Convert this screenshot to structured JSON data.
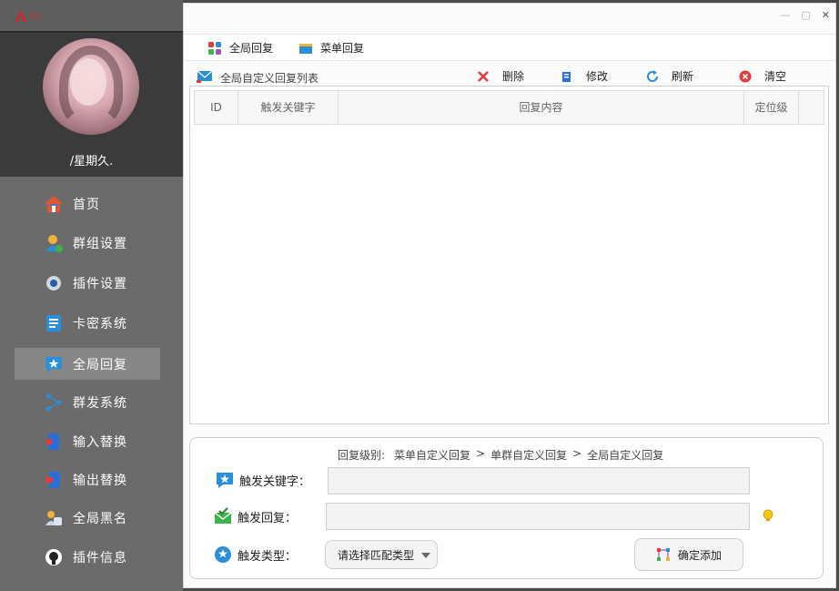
{
  "sidebar": {
    "logo_text": "花开",
    "username": "/星期久.",
    "items": [
      {
        "label": "首页",
        "icon": "home-icon"
      },
      {
        "label": "群组设置",
        "icon": "group-icon"
      },
      {
        "label": "插件设置",
        "icon": "gear-icon"
      },
      {
        "label": "卡密系统",
        "icon": "card-icon"
      },
      {
        "label": "全局回复",
        "icon": "star-chat-icon",
        "active": true
      },
      {
        "label": "群发系统",
        "icon": "broadcast-icon"
      },
      {
        "label": "输入替换",
        "icon": "input-icon"
      },
      {
        "label": "输出替换",
        "icon": "output-icon"
      },
      {
        "label": "全局黑名",
        "icon": "blacklist-icon"
      },
      {
        "label": "插件信息",
        "icon": "github-icon"
      }
    ]
  },
  "window": {
    "controls": [
      "—",
      "▢",
      "✕"
    ]
  },
  "toolbar": {
    "global_reply": "全局回复",
    "menu_reply": "菜单回复"
  },
  "list": {
    "title": "全局自定义回复列表",
    "delete": "删除",
    "edit": "修改",
    "refresh": "刷新",
    "clear": "清空",
    "columns": [
      "ID",
      "触发关键字",
      "回复内容",
      "定位级",
      ""
    ]
  },
  "form": {
    "level_label": "回复级别:",
    "levels": [
      "菜单自定义回复",
      ">",
      "单群自定义回复",
      ">",
      "全局自定义回复"
    ],
    "keyword_label": "触发关键字：",
    "keyword_value": "",
    "reply_label": "触发回复：",
    "reply_value": "",
    "type_label": "触发类型：",
    "type_select": "请选择匹配类型",
    "confirm_button": "确定添加"
  },
  "colors": {
    "sidebar_bg": "#6b6b6b",
    "profile_bg": "#3b3b3b",
    "active_item": "#878787",
    "accent_blue": "#2a8ed8"
  }
}
